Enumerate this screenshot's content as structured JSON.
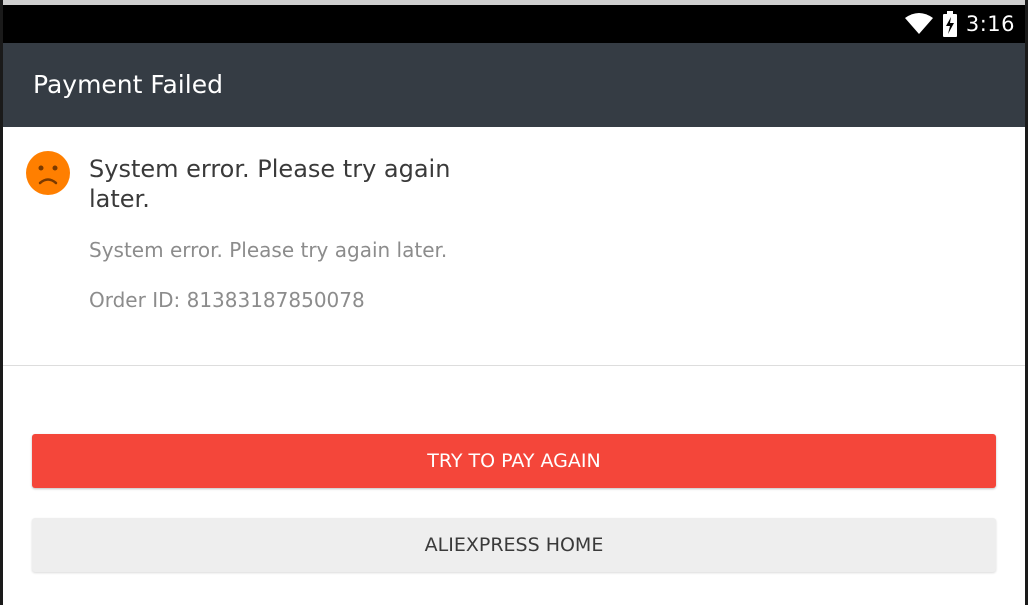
{
  "status_bar": {
    "time": "3:16",
    "icons": [
      "wifi-icon",
      "battery-charging-icon"
    ],
    "background_color": "#000000"
  },
  "app_bar": {
    "title": "Payment Failed",
    "background_color": "#353c44"
  },
  "error": {
    "icon": "sad-face-icon",
    "icon_color": "#ff7f00",
    "title": "System error. Please try again later.",
    "detail": "System error. Please try again later.",
    "order_id_label": "Order ID: 81383187850078"
  },
  "actions": {
    "try_again_label": "TRY TO PAY AGAIN",
    "try_again_color": "#f4463a",
    "home_label": "ALIEXPRESS HOME"
  }
}
